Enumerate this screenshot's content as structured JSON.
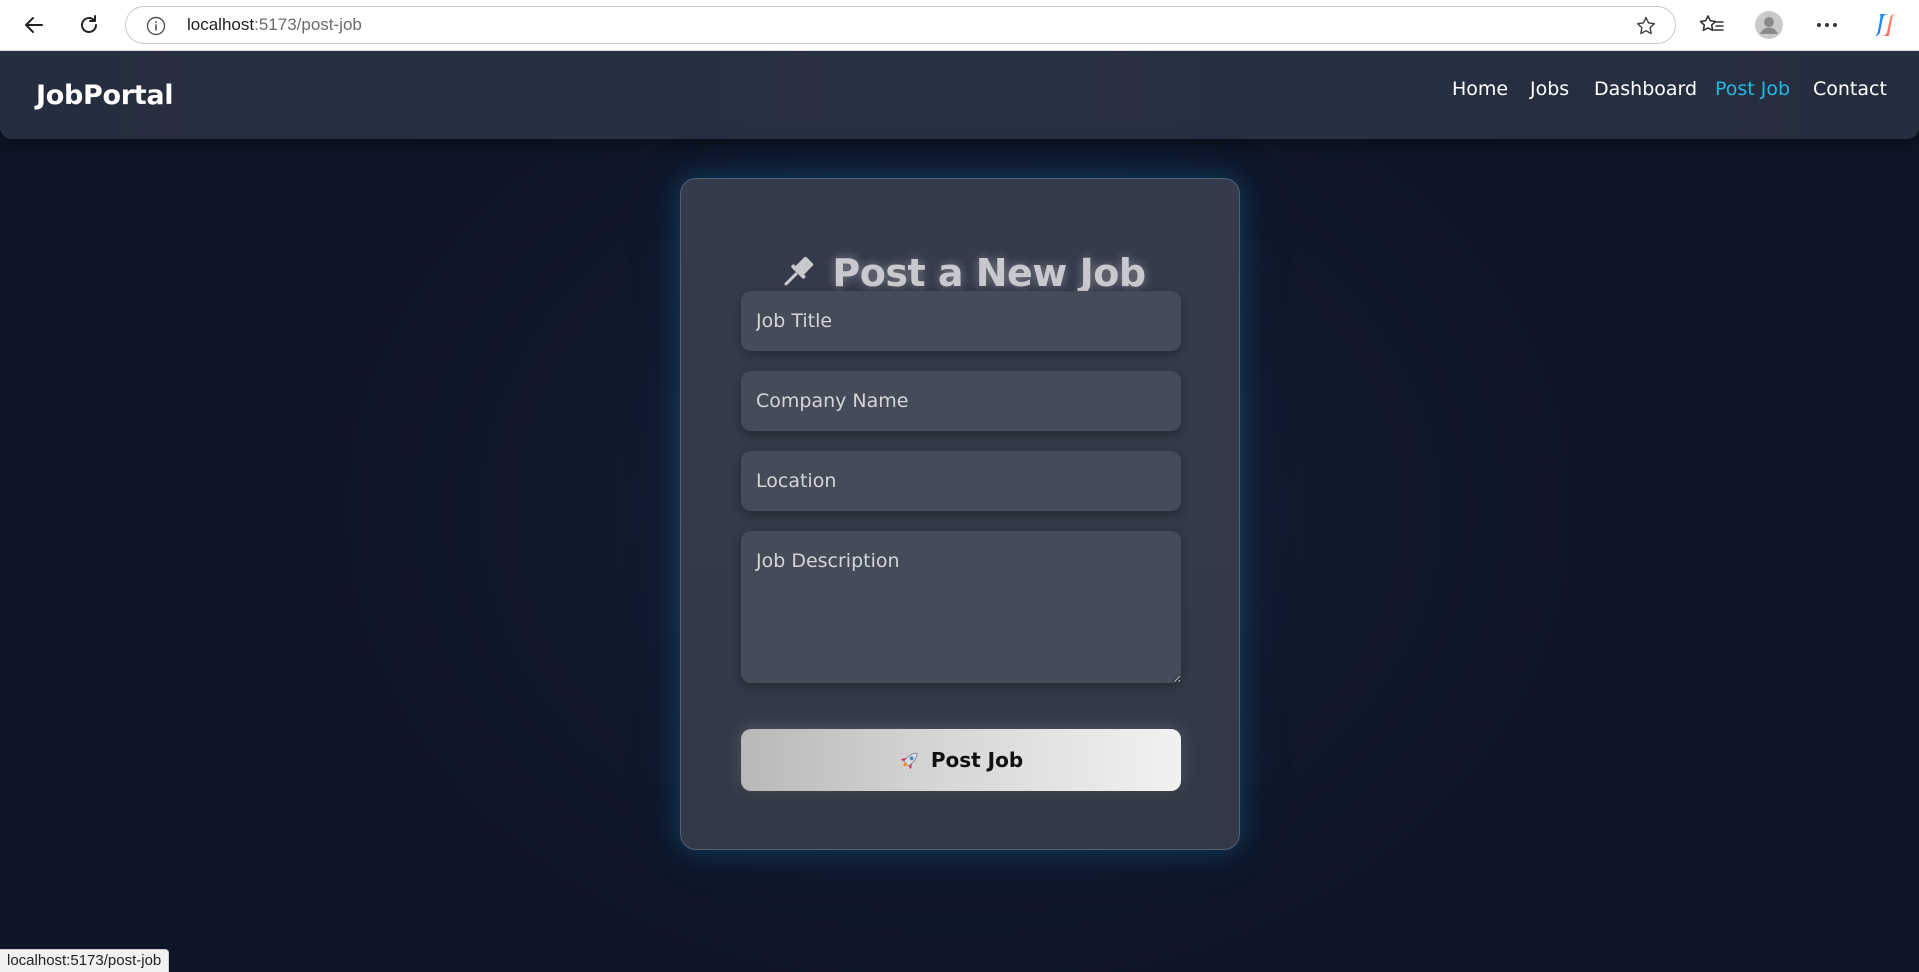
{
  "browser": {
    "url_host": "localhost",
    "url_path": ":5173/post-job",
    "status_url": "localhost:5173/post-job"
  },
  "navbar": {
    "brand": "JobPortal",
    "links": [
      {
        "label": "Home",
        "active": false
      },
      {
        "label": "Jobs",
        "active": false
      },
      {
        "label": "Dashboard",
        "active": false
      },
      {
        "label": "Post Job",
        "active": true
      },
      {
        "label": "Contact",
        "active": false
      }
    ]
  },
  "form": {
    "title": "Post a New Job",
    "title_icon": "pushpin-icon",
    "fields": {
      "job_title": {
        "placeholder": "Job Title",
        "value": ""
      },
      "company_name": {
        "placeholder": "Company Name",
        "value": ""
      },
      "location": {
        "placeholder": "Location",
        "value": ""
      },
      "job_description": {
        "placeholder": "Job Description",
        "value": ""
      }
    },
    "submit_label": "Post Job",
    "submit_icon": "rocket-icon"
  },
  "colors": {
    "background": "#0d1526",
    "navbar": "#262f3f",
    "active_link": "#22b8e6",
    "card": "#343a48",
    "card_border": "#4e6277",
    "input": "#464b59"
  }
}
